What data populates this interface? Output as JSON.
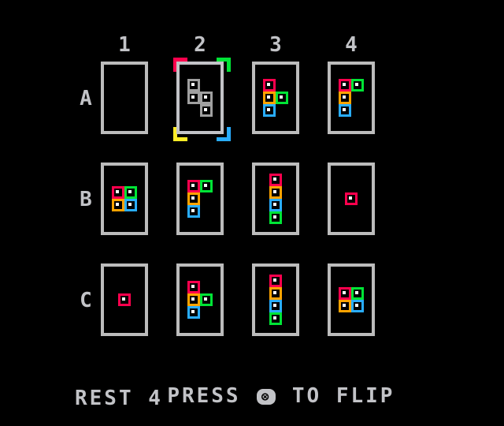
{
  "columns": [
    "1",
    "2",
    "3",
    "4"
  ],
  "rows": [
    "A",
    "B",
    "C"
  ],
  "colors": {
    "red": "#ff004d",
    "green": "#00e436",
    "yellow": "#ffa300",
    "blue": "#29adff",
    "gray": "#a0a0a0",
    "card_border": "#bcbcbc",
    "text": "#c2c3c7",
    "cursor_top_left": "#ff004d",
    "cursor_top_right": "#00e436",
    "cursor_bottom_left": "#ffec27",
    "cursor_bottom_right": "#29adff"
  },
  "selected_card": "A2",
  "cards": {
    "A1": [],
    "A2": [
      [
        0,
        0,
        "gray"
      ],
      [
        0,
        1,
        "gray"
      ],
      [
        1,
        1,
        "gray"
      ],
      [
        1,
        2,
        "gray"
      ]
    ],
    "A3": [
      [
        0,
        0,
        "red"
      ],
      [
        0,
        1,
        "yellow"
      ],
      [
        1,
        1,
        "green"
      ],
      [
        0,
        2,
        "blue"
      ]
    ],
    "A4": [
      [
        0,
        0,
        "red"
      ],
      [
        1,
        0,
        "green"
      ],
      [
        0,
        1,
        "yellow"
      ],
      [
        0,
        2,
        "blue"
      ]
    ],
    "B1": [
      [
        0,
        0,
        "red"
      ],
      [
        1,
        0,
        "green"
      ],
      [
        0,
        1,
        "yellow"
      ],
      [
        1,
        1,
        "blue"
      ]
    ],
    "B2": [
      [
        0,
        0,
        "red"
      ],
      [
        1,
        0,
        "green"
      ],
      [
        0,
        1,
        "yellow"
      ],
      [
        0,
        2,
        "blue"
      ]
    ],
    "B3": [
      [
        0,
        0,
        "red"
      ],
      [
        0,
        1,
        "yellow"
      ],
      [
        0,
        2,
        "blue"
      ],
      [
        0,
        3,
        "green"
      ]
    ],
    "B4": [
      [
        0,
        0,
        "red"
      ]
    ],
    "C1": [
      [
        0,
        0,
        "red"
      ]
    ],
    "C2": [
      [
        0,
        0,
        "red"
      ],
      [
        0,
        1,
        "yellow"
      ],
      [
        1,
        1,
        "green"
      ],
      [
        0,
        2,
        "blue"
      ]
    ],
    "C3": [
      [
        0,
        0,
        "red"
      ],
      [
        0,
        1,
        "yellow"
      ],
      [
        0,
        2,
        "blue"
      ],
      [
        0,
        3,
        "green"
      ]
    ],
    "C4": [
      [
        0,
        0,
        "red"
      ],
      [
        1,
        0,
        "green"
      ],
      [
        0,
        1,
        "yellow"
      ],
      [
        1,
        1,
        "blue"
      ]
    ]
  },
  "prompt": {
    "before": "PRESS ",
    "button": "⊗",
    "after": " TO FLIP"
  },
  "status": "REST 4"
}
